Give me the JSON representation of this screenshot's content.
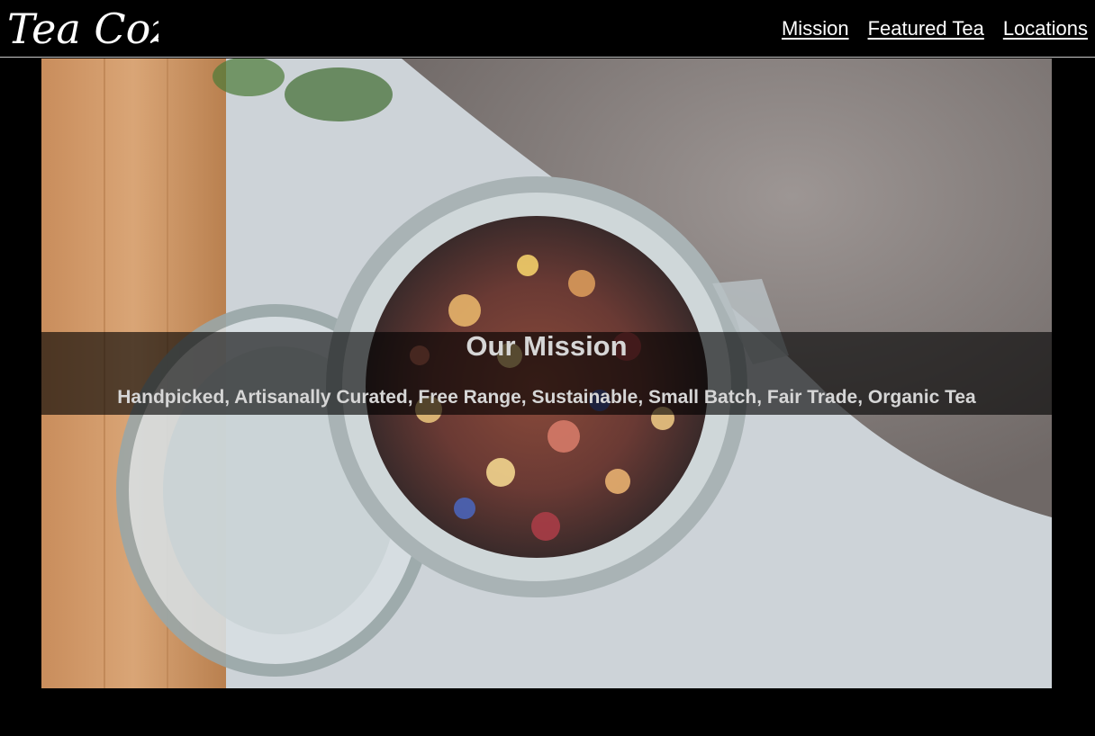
{
  "header": {
    "logo_text": "Tea Cozy",
    "nav": [
      {
        "label": "Mission"
      },
      {
        "label": "Featured Tea"
      },
      {
        "label": "Locations"
      }
    ]
  },
  "hero": {
    "image_subject": "jar-of-loose-leaf-tea",
    "title": "Our Mission",
    "subtitle": "Handpicked, Artisanally Curated, Free Range, Sustainable, Small Batch, Fair Trade, Organic Tea"
  },
  "colors": {
    "background": "#000000",
    "text": "#ffffff",
    "banner_text": "#d6d6d6"
  }
}
